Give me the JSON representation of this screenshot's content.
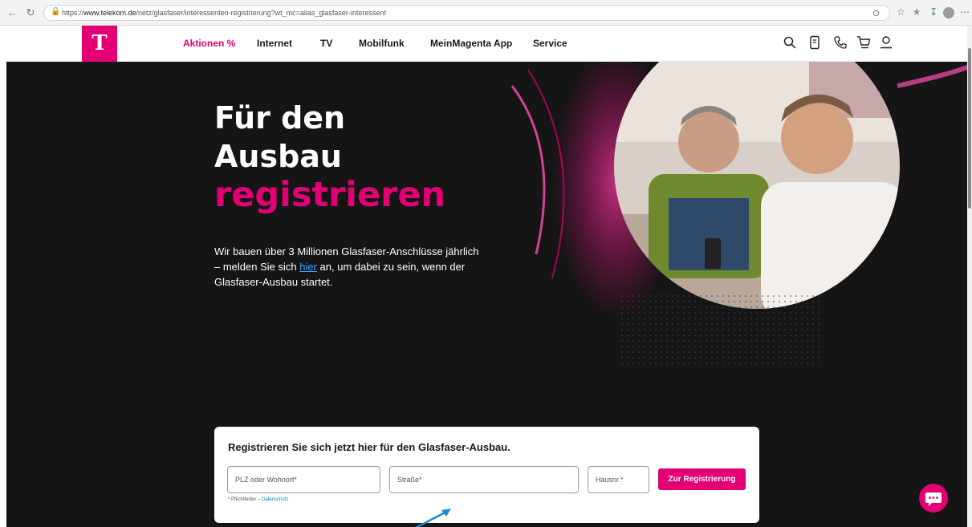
{
  "browser": {
    "url_prefix": "https://",
    "url_domain": "www.telekom.de",
    "url_path": "/netz/glasfaser/interessenten-registrierung?wt_mc=alias_glasfaser-interessent"
  },
  "header": {
    "logo": "T",
    "nav": [
      {
        "label": "Aktionen %",
        "active": true
      },
      {
        "label": "Internet",
        "active": false
      },
      {
        "label": "TV",
        "active": false
      },
      {
        "label": "Mobilfunk",
        "active": false
      },
      {
        "label": "MeinMagenta App",
        "active": false
      },
      {
        "label": "Service",
        "active": false
      }
    ],
    "icons": [
      "search-icon",
      "tariff-icon",
      "phone-icon",
      "cart-icon",
      "user-icon"
    ]
  },
  "hero": {
    "headline_1": "Für den",
    "headline_2": "Ausbau",
    "headline_3": "registrieren",
    "intro_before": "Wir bauen über 3 Millionen Glasfaser-Anschlüsse jährlich – melden Sie sich ",
    "intro_link": "hier",
    "intro_after": " an, um dabei zu sein, wenn der Glasfaser-Ausbau startet."
  },
  "form": {
    "title": "Registrieren Sie sich jetzt hier für den Glasfaser-Ausbau.",
    "plz_placeholder": "PLZ oder Wohnort*",
    "street_placeholder": "Straße*",
    "house_placeholder": "Hausnr.*",
    "submit_label": "Zur Registrierung",
    "footnote": "* Pflichtfelder – ",
    "privacy_link": "Datenschutz"
  },
  "colors": {
    "brand": "#e20074",
    "hero_bg": "#151515",
    "link": "#3ea0ff"
  }
}
